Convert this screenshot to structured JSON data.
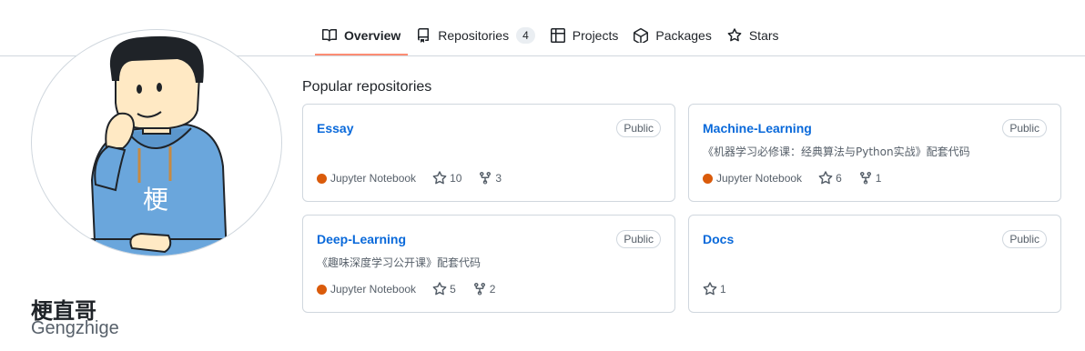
{
  "tabs": [
    {
      "label": "Overview",
      "icon": "book-icon",
      "active": true
    },
    {
      "label": "Repositories",
      "icon": "repo-icon",
      "count": "4"
    },
    {
      "label": "Projects",
      "icon": "table-icon"
    },
    {
      "label": "Packages",
      "icon": "package-icon"
    },
    {
      "label": "Stars",
      "icon": "star-icon"
    }
  ],
  "profile": {
    "avatar_text": "梗",
    "name": "梗直哥",
    "login": "Gengzhige"
  },
  "popular": {
    "title": "Popular repositories",
    "repos": [
      {
        "name": "Essay",
        "visibility": "Public",
        "description": "",
        "language": "Jupyter Notebook",
        "language_color": "#DA5B0B",
        "stars": "10",
        "forks": "3"
      },
      {
        "name": "Machine-Learning",
        "visibility": "Public",
        "description": "《机器学习必修课：经典算法与Python实战》配套代码",
        "language": "Jupyter Notebook",
        "language_color": "#DA5B0B",
        "stars": "6",
        "forks": "1"
      },
      {
        "name": "Deep-Learning",
        "visibility": "Public",
        "description": "《趣味深度学习公开课》配套代码",
        "language": "Jupyter Notebook",
        "language_color": "#DA5B0B",
        "stars": "5",
        "forks": "2"
      },
      {
        "name": "Docs",
        "visibility": "Public",
        "description": "",
        "stars": "1"
      }
    ]
  },
  "colors": {
    "link": "#0969da",
    "tab_underline": "#fd8c73",
    "border": "#d0d7de",
    "muted": "#57606a",
    "hoodie": "#6aa6dc"
  }
}
